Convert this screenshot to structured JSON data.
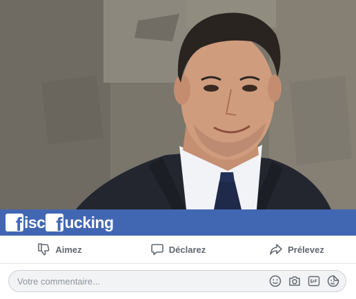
{
  "banner": {
    "logo_part1": "isc",
    "logo_part2": "ucking",
    "logo_box_letter": "f",
    "background_color": "#4267b2"
  },
  "actions": [
    {
      "label": "Aimez",
      "icon": "thumbs-down-icon"
    },
    {
      "label": "Déclarez",
      "icon": "speech-bubble-icon"
    },
    {
      "label": "Prélevez",
      "icon": "share-arrow-icon"
    }
  ],
  "comment": {
    "placeholder": "Votre commentaire...",
    "icons": [
      "smiley-icon",
      "camera-icon",
      "gif-icon",
      "sticker-icon"
    ]
  },
  "colors": {
    "action_text": "#606770",
    "divider": "#e2e4e8",
    "input_bg": "#f2f3f5"
  }
}
